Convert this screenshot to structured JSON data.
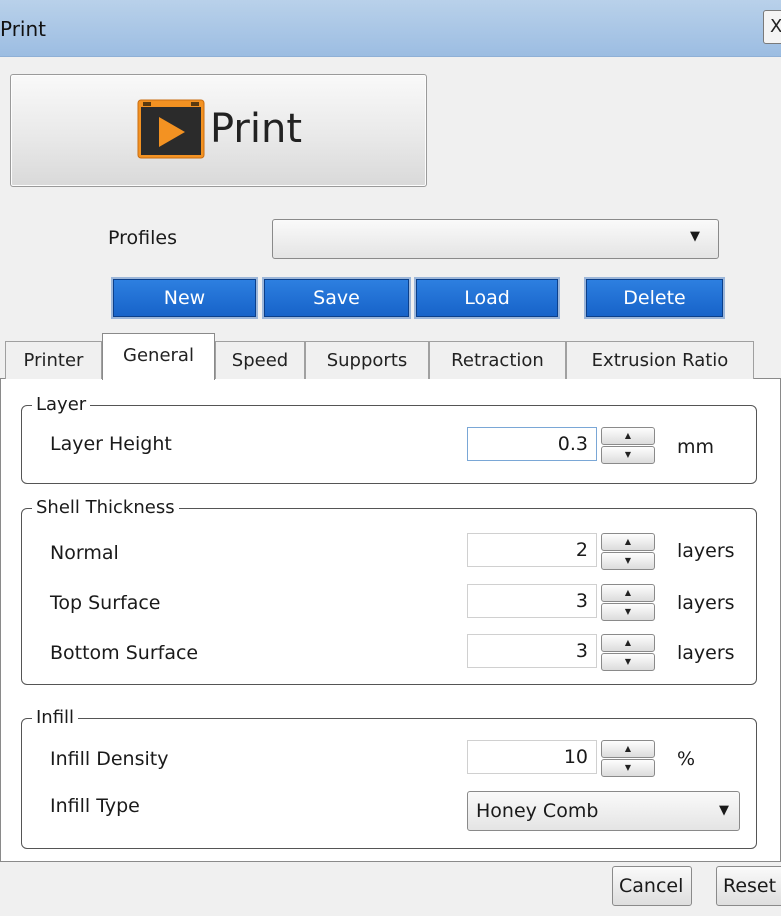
{
  "window": {
    "title": "Print",
    "close_glyph": "X"
  },
  "print_button": {
    "label": "Print",
    "icon": "print-play-icon",
    "icon_color": "#f39222"
  },
  "profiles": {
    "label": "Profiles",
    "selected": ""
  },
  "actions": {
    "new": "New",
    "save": "Save",
    "load": "Load",
    "delete": "Delete",
    "accent": "#1f6fd8"
  },
  "tabs": [
    {
      "label": "Printer"
    },
    {
      "label": "General",
      "active": true
    },
    {
      "label": "Speed"
    },
    {
      "label": "Supports"
    },
    {
      "label": "Retraction"
    },
    {
      "label": "Extrusion Ratio"
    }
  ],
  "layer": {
    "legend": "Layer",
    "height": {
      "label": "Layer Height",
      "value": "0.3",
      "unit": "mm"
    }
  },
  "shell": {
    "legend": "Shell Thickness",
    "normal": {
      "label": "Normal",
      "value": "2",
      "unit": "layers"
    },
    "top": {
      "label": "Top Surface",
      "value": "3",
      "unit": "layers"
    },
    "bottom": {
      "label": "Bottom Surface",
      "value": "3",
      "unit": "layers"
    }
  },
  "infill": {
    "legend": "Infill",
    "density": {
      "label": "Infill Density",
      "value": "10",
      "unit": "%"
    },
    "type": {
      "label": "Infill Type",
      "value": "Honey Comb"
    }
  },
  "footer": {
    "cancel": "Cancel",
    "reset": "Reset"
  }
}
